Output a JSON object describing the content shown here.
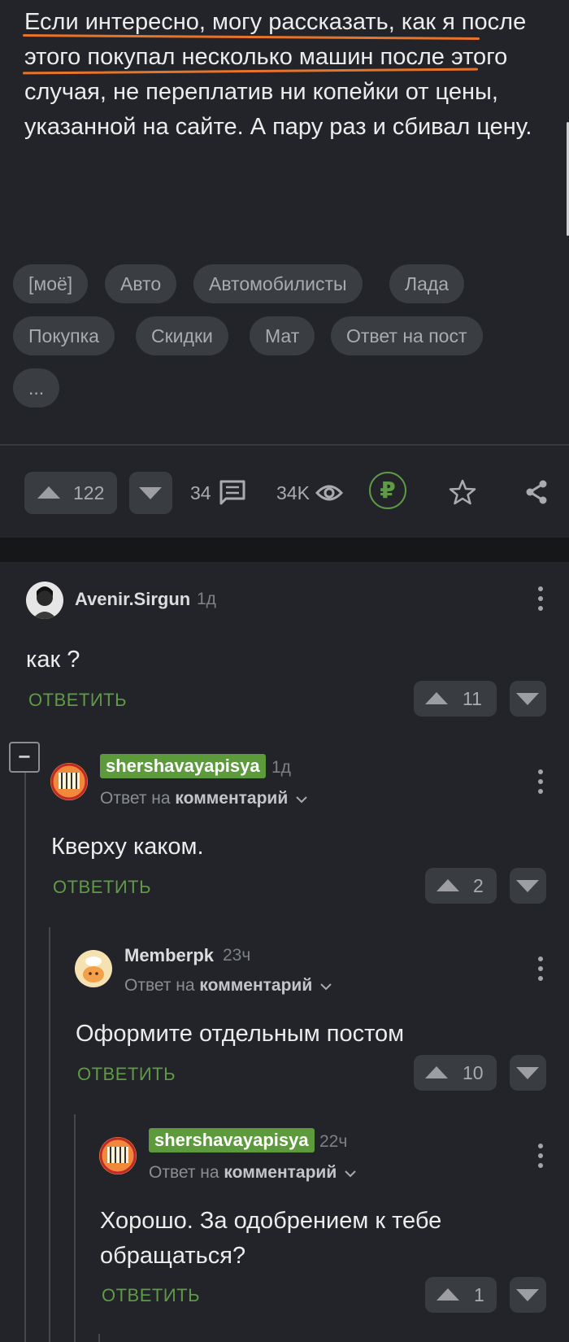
{
  "post": {
    "text": "Если интересно, могу рассказать, как я после этого покупал несколько машин после этого случая, не переплатив ни копейки от цены, указанной на сайте. А пару раз и сбивал цену.",
    "tags": [
      "[моё]",
      "Авто",
      "Автомобилисты",
      "Лада",
      "Покупка",
      "Скидки",
      "Мат",
      "Ответ на пост",
      "..."
    ]
  },
  "actions": {
    "rating": "122",
    "comments": "34",
    "views": "34K",
    "donate_symbol": "₽"
  },
  "comments": [
    {
      "user": "Avenir.Sirgun",
      "time": "1д",
      "text": "как ?",
      "reply_label": "ОТВЕТИТЬ",
      "votes": "11"
    },
    {
      "user": "shershavayapisya",
      "time": "1д",
      "reply_prefix": "Ответ на ",
      "reply_target": "комментарий",
      "text": "Кверху каком.",
      "reply_label": "ОТВЕТИТЬ",
      "votes": "2",
      "collapse_symbol": "−"
    },
    {
      "user": "Memberpk",
      "time": "23ч",
      "reply_prefix": "Ответ на ",
      "reply_target": "комментарий",
      "text": "Оформите отдельным постом",
      "reply_label": "ОТВЕТИТЬ",
      "votes": "10"
    },
    {
      "user": "shershavayapisya",
      "time": "22ч",
      "reply_prefix": "Ответ на ",
      "reply_target": "комментарий",
      "text": "Хорошо. За одобрением к тебе обращаться?",
      "reply_label": "ОТВЕТИТЬ",
      "votes": "1"
    }
  ],
  "colors": {
    "background": "#222429",
    "accent_green": "#5f9a45",
    "highlight_underline": "#e8742a",
    "username_badge": "#5c9a3c"
  },
  "icons": [
    "upvote-icon",
    "downvote-icon",
    "comments-icon",
    "eye-icon",
    "ruble-icon",
    "star-icon",
    "share-icon",
    "more-icon",
    "chevron-down-icon",
    "collapse-icon"
  ]
}
